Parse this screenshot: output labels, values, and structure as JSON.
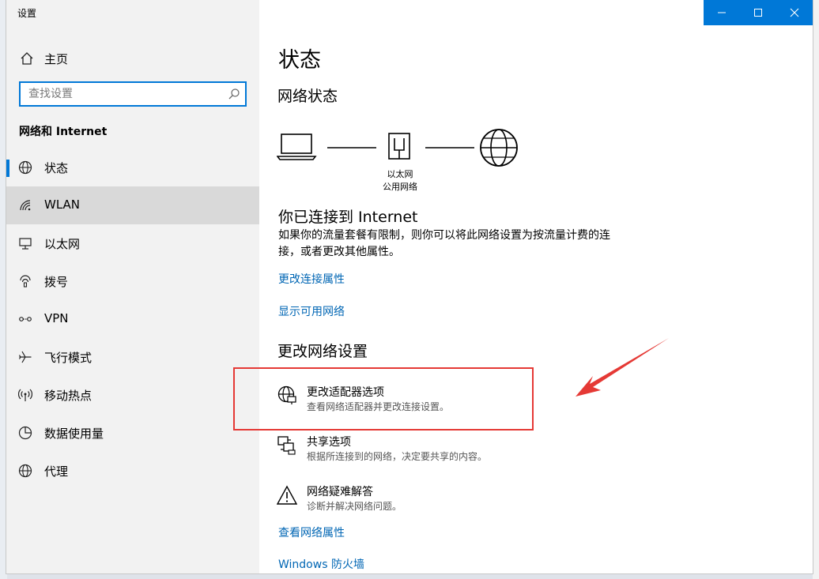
{
  "window": {
    "title": "设置"
  },
  "sidebar": {
    "home_label": "主页",
    "search_placeholder": "查找设置",
    "section_title": "网络和 Internet",
    "items": [
      {
        "label": "状态",
        "icon": "globe-status-icon"
      },
      {
        "label": "WLAN",
        "icon": "wifi-icon"
      },
      {
        "label": "以太网",
        "icon": "ethernet-icon"
      },
      {
        "label": "拨号",
        "icon": "dialup-icon"
      },
      {
        "label": "VPN",
        "icon": "vpn-icon"
      },
      {
        "label": "飞行模式",
        "icon": "airplane-icon"
      },
      {
        "label": "移动热点",
        "icon": "hotspot-icon"
      },
      {
        "label": "数据使用量",
        "icon": "data-usage-icon"
      },
      {
        "label": "代理",
        "icon": "proxy-globe-icon"
      }
    ],
    "selected_item": "状态",
    "hovered_item": "WLAN"
  },
  "main": {
    "title": "状态",
    "network_status_heading": "网络状态",
    "diagram": {
      "adapter_name": "以太网",
      "network_type": "公用网络"
    },
    "connected_title": "你已连接到 Internet",
    "connected_desc": "如果你的流量套餐有限制，则你可以将此网络设置为按流量计费的连接，或者更改其他属性。",
    "links": {
      "change_connection_properties": "更改连接属性",
      "show_available_networks": "显示可用网络",
      "view_network_properties": "查看网络属性",
      "windows_firewall": "Windows 防火墙"
    },
    "change_settings_heading": "更改网络设置",
    "options": [
      {
        "title": "更改适配器选项",
        "desc": "查看网络适配器并更改连接设置。",
        "icon": "adapter-globe-icon"
      },
      {
        "title": "共享选项",
        "desc": "根据所连接到的网络，决定要共享的内容。",
        "icon": "sharing-icon"
      },
      {
        "title": "网络疑难解答",
        "desc": "诊断并解决网络问题。",
        "icon": "warning-icon"
      }
    ]
  },
  "colors": {
    "accent": "#0078d7",
    "link": "#0066b4",
    "annotation": "#e53935"
  }
}
